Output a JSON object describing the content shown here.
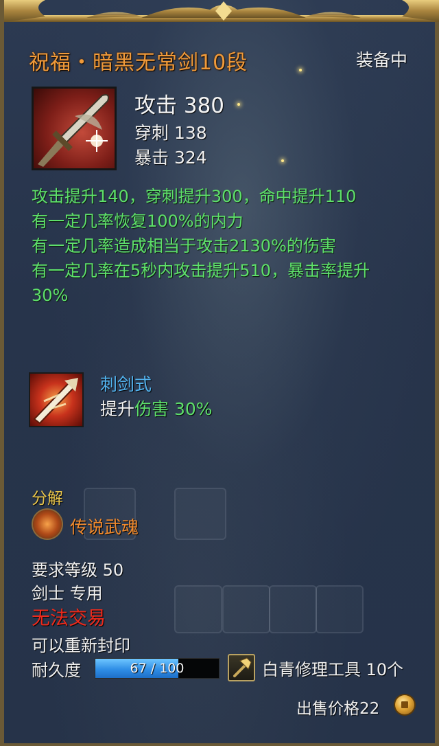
{
  "item": {
    "name": "祝福・暗黑无常剑10段",
    "equip_status": "装备中",
    "icon": "sword-icon"
  },
  "stats": {
    "attack": "攻击 380",
    "pierce": "穿刺 138",
    "crit": "暴击 324"
  },
  "effects": [
    "攻击提升140，穿刺提升300，命中提升110",
    "有一定几率恢复100%的内力",
    "有一定几率造成相当于攻击2130%的伤害",
    "有一定几率在5秒内攻击提升510，暴击率提升",
    "30%"
  ],
  "skill": {
    "name": "刺剑式",
    "desc_prefix": "提升",
    "desc_highlight": "伤害 30%",
    "icon": "thrust-sword-skill-icon"
  },
  "dismantle": {
    "label": "分解",
    "result": "传说武魂",
    "icon": "weapon-soul-icon"
  },
  "requirements": {
    "level": "要求等级 50",
    "class": "剑士 专用"
  },
  "trade": "无法交易",
  "reseal": "可以重新封印",
  "durability": {
    "label": "耐久度",
    "current": 67,
    "max": 100,
    "text": "67 / 100",
    "fraction": 0.67
  },
  "repair_tool": {
    "label": "白青修理工具 10个",
    "icon": "hammer-icon"
  },
  "price": {
    "label": "出售价格22",
    "icon": "coin-icon"
  },
  "colors": {
    "title": "#f09a3a",
    "effect_green": "#5ee06a",
    "skill_blue": "#52b2ee",
    "untradeable_red": "#ee2a1c",
    "dismantle_gold": "#e8c54c",
    "durability_blue": "#2f8ee6"
  }
}
